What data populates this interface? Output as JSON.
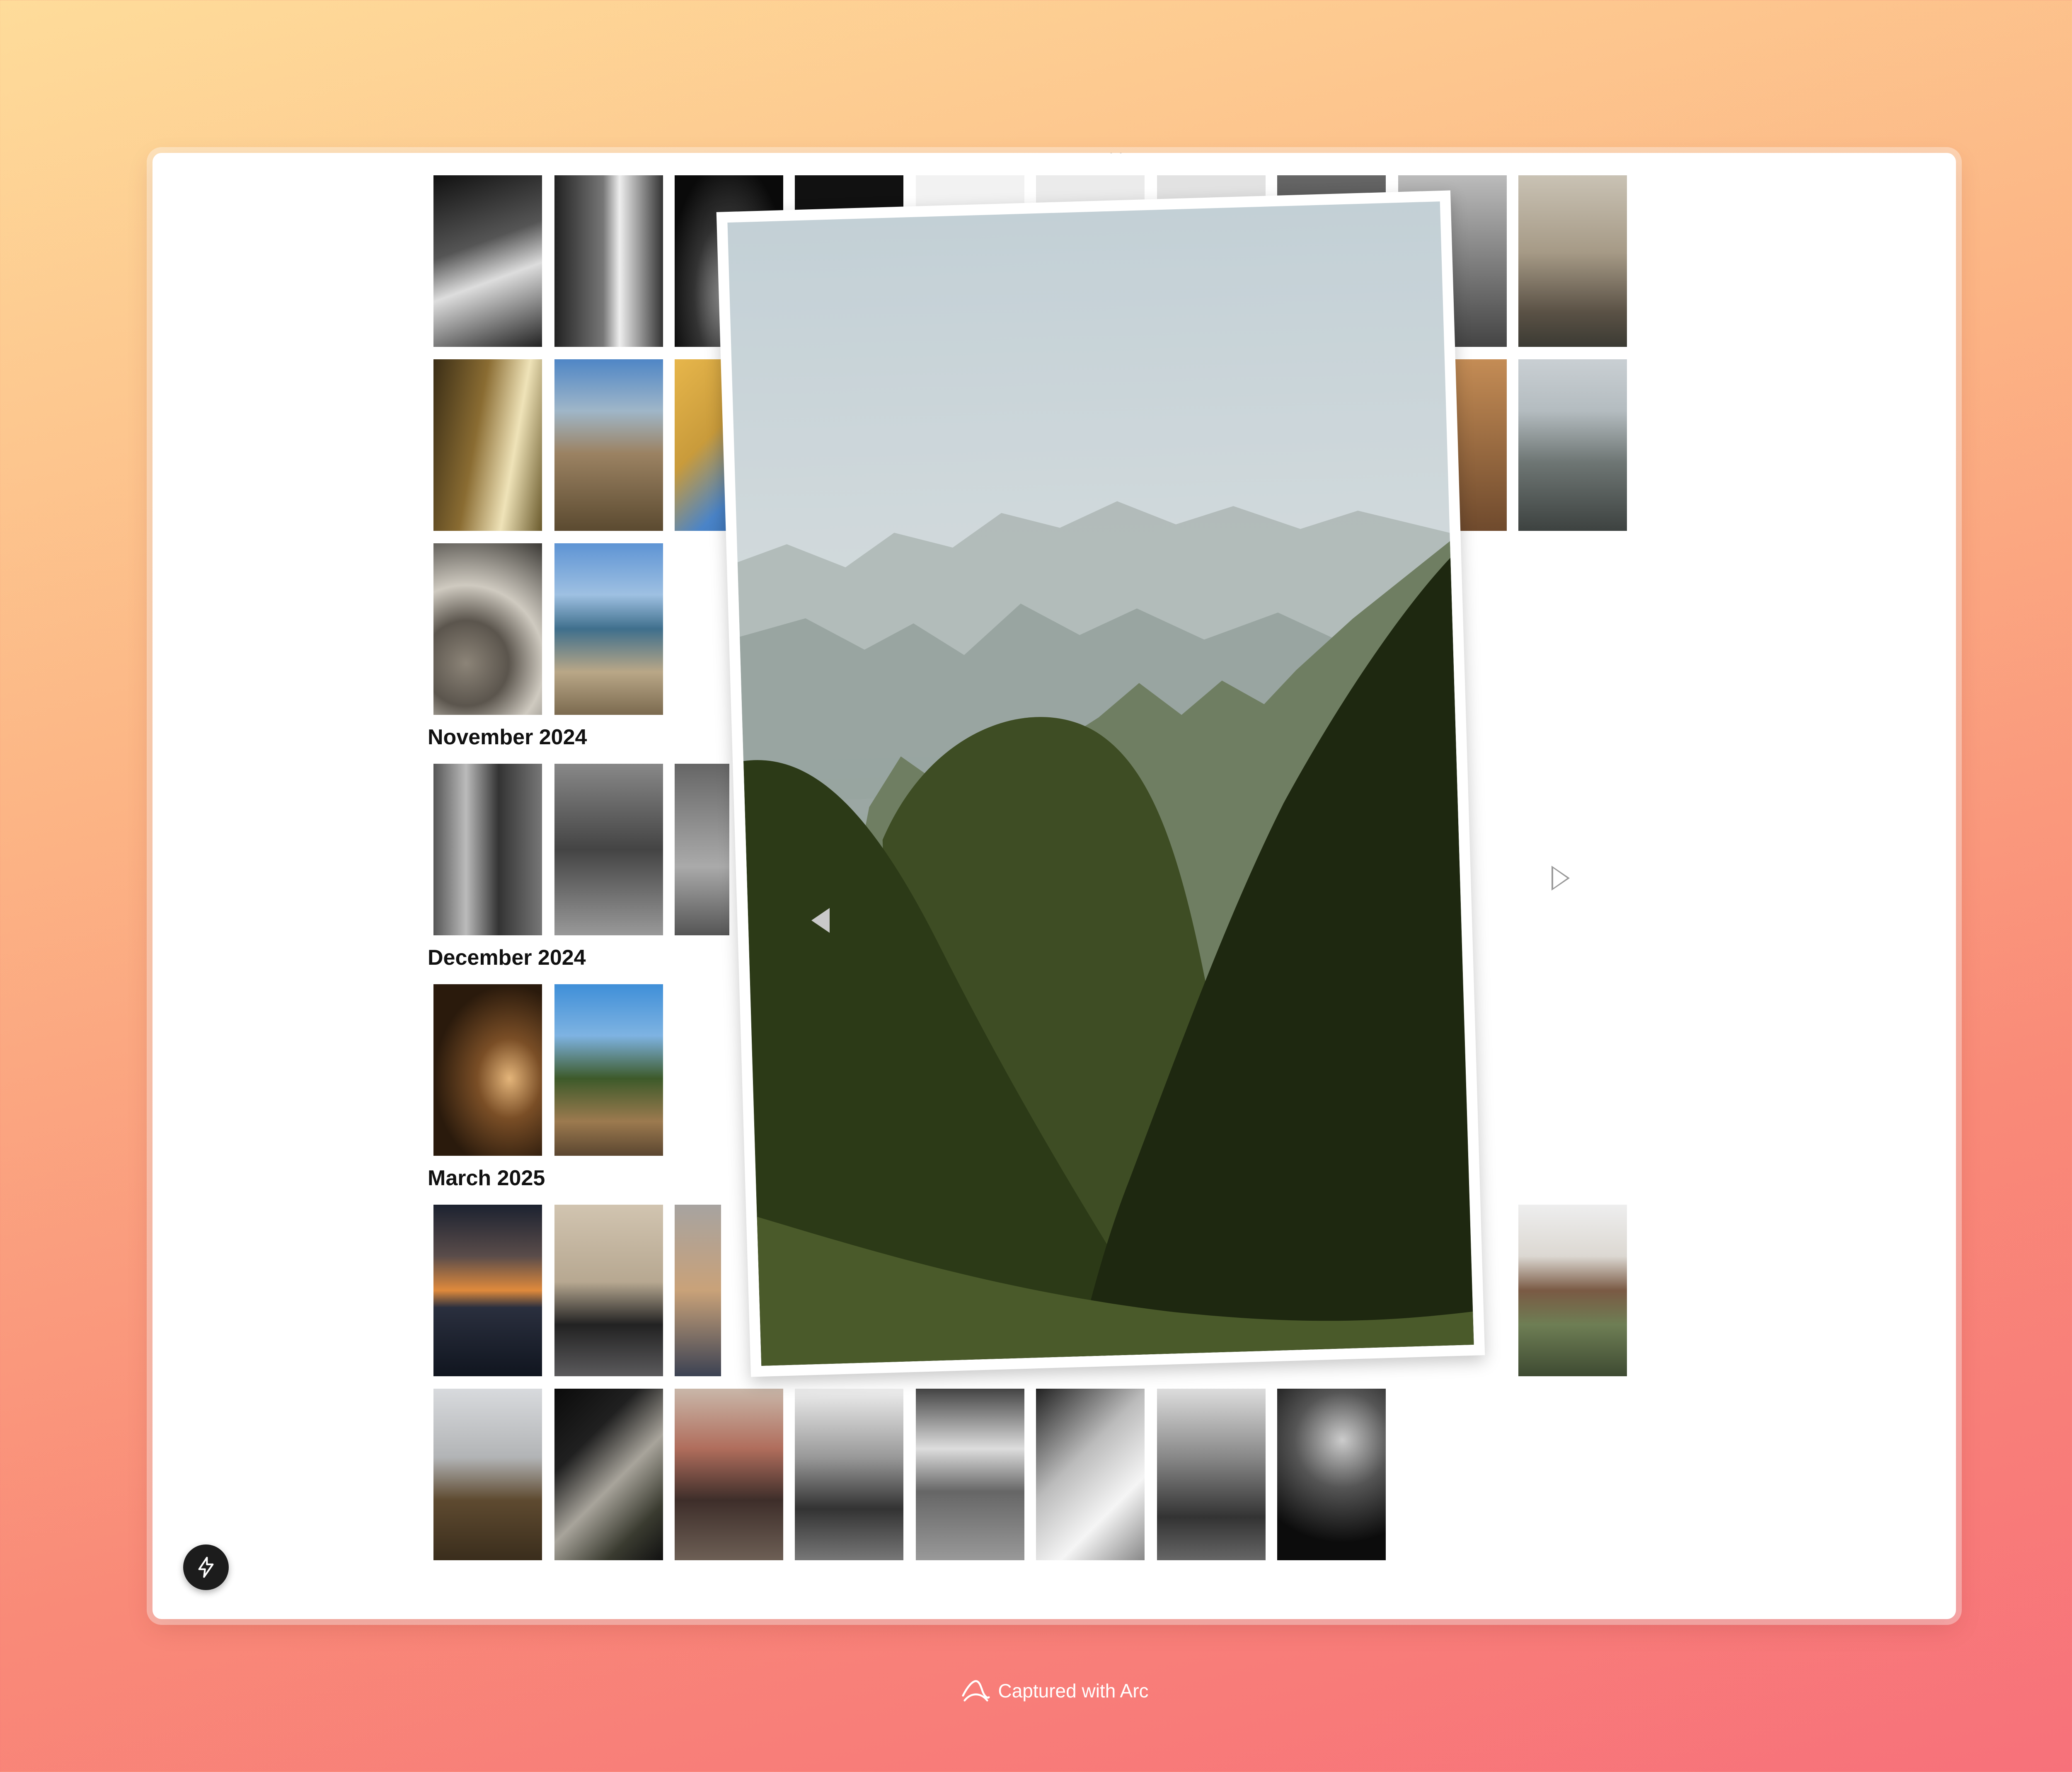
{
  "window": {
    "close_glyph": "ˇˇ",
    "sections": [
      {
        "label": "November 2024"
      },
      {
        "label": "December 2024"
      },
      {
        "label": "March 2025"
      }
    ]
  },
  "viewer": {
    "photo_icon": "mountain-landscape-photo",
    "prev_icon": "chevron-left-icon",
    "next_icon": "chevron-right-icon"
  },
  "fab": {
    "icon": "bolt-icon"
  },
  "footer": {
    "text": "Captured with Arc",
    "icon": "arc-logo-icon"
  },
  "colors": {
    "background_top": "#fedc9a",
    "background_bottom": "#f7717a",
    "panel": "#ffffff"
  }
}
